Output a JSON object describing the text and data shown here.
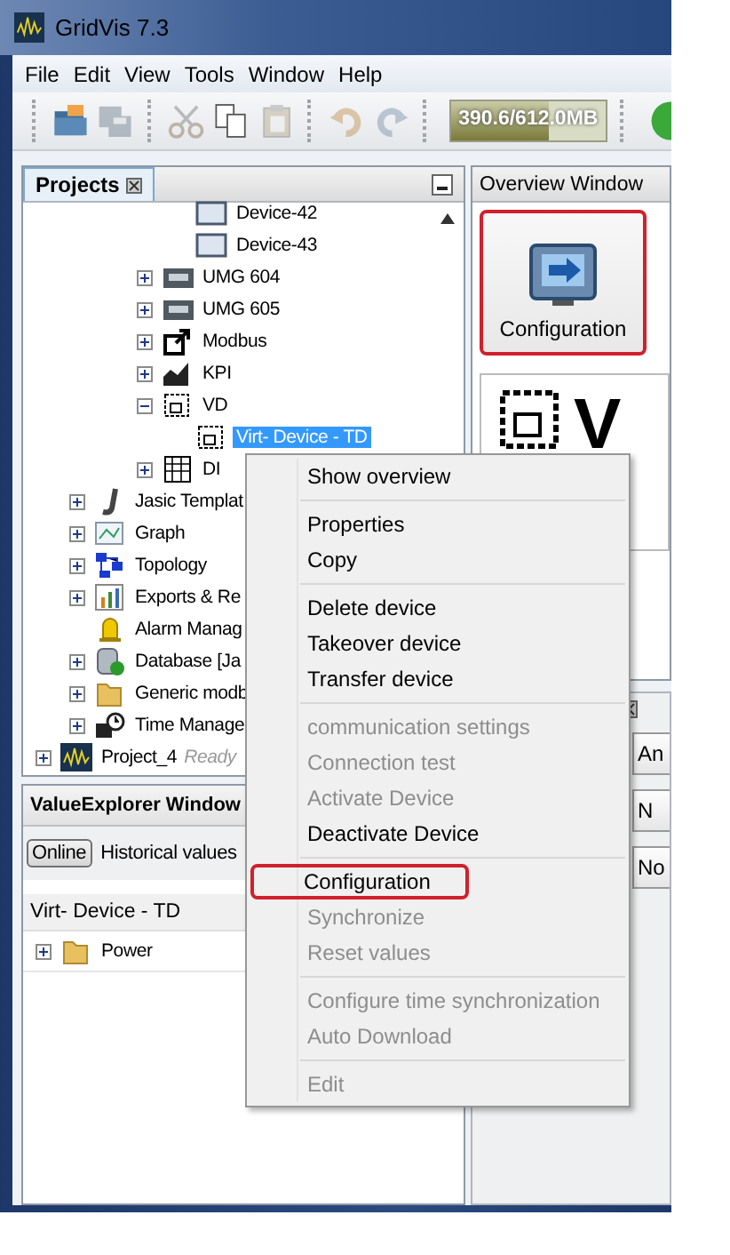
{
  "window": {
    "title": "GridVis 7.3"
  },
  "menu_bar": [
    "File",
    "Edit",
    "View",
    "Tools",
    "Window",
    "Help"
  ],
  "toolbar": {
    "buttons": [
      {
        "kind": "open",
        "disabled": false
      },
      {
        "kind": "save",
        "disabled": true
      },
      {
        "kind": "cut",
        "disabled": true
      },
      {
        "kind": "copy",
        "disabled": false
      },
      {
        "kind": "paste",
        "disabled": true
      },
      {
        "kind": "undo",
        "disabled": true
      },
      {
        "kind": "redo",
        "disabled": true
      }
    ],
    "memory": {
      "reading": "390.6/612.0MB",
      "level": 0.64
    }
  },
  "projects": {
    "title": "Projects",
    "tree": [
      {
        "children": [
          {
            "children": [
              {
                "children": [
                  {
                    "children": [
                      {
                        "label": "Device-42",
                        "kind": "monitor",
                        "selected": false
                      },
                      {
                        "label": "Device-43",
                        "kind": "monitor",
                        "selected": false
                      }
                    ]
                  },
                  {
                    "label": "UMG 604",
                    "kind": "meter",
                    "expanded": false,
                    "selected": false
                  },
                  {
                    "label": "UMG 605",
                    "kind": "meter",
                    "expanded": false,
                    "selected": false
                  },
                  {
                    "label": "Modbus",
                    "kind": "modbus",
                    "expanded": false,
                    "selected": false
                  },
                  {
                    "label": "KPI",
                    "kind": "kpi",
                    "expanded": false,
                    "selected": false
                  },
                  {
                    "label": "VD",
                    "kind": "virtual",
                    "expanded": true,
                    "selected": false,
                    "children": [
                      {
                        "label": "Virt- Device - TD",
                        "kind": "virtual",
                        "selected": true
                      }
                    ]
                  },
                  {
                    "label": "DI",
                    "kind": "di",
                    "expanded": false,
                    "selected": false
                  }
                ]
              }
            ]
          },
          {
            "label": "Jasic Templat",
            "kind": "script",
            "expanded": false,
            "selected": false
          },
          {
            "label": "Graph",
            "kind": "graph",
            "expanded": false,
            "selected": false
          },
          {
            "label": "Topology",
            "kind": "topology",
            "expanded": false,
            "selected": false
          },
          {
            "label": "Exports & Re",
            "kind": "report",
            "expanded": false,
            "selected": false
          },
          {
            "label": "Alarm Manag",
            "kind": "alarm",
            "selected": false
          },
          {
            "label": "Database [Ja",
            "kind": "database",
            "expanded": false,
            "selected": false
          },
          {
            "label": "Generic modb",
            "kind": "folder",
            "expanded": false,
            "selected": false
          },
          {
            "label": "Time Manage",
            "kind": "clock",
            "expanded": false,
            "selected": false
          }
        ]
      },
      {
        "label": "Project_4",
        "status": "Ready",
        "kind": "project",
        "expanded": false,
        "selected": false
      }
    ]
  },
  "value_explorer": {
    "title": "ValueExplorer Window",
    "modes": [
      {
        "label": "Online",
        "selected": true
      },
      {
        "label": "Historical values",
        "selected": false
      }
    ],
    "column": "Virt- Device - TD",
    "tree": [
      {
        "label": "Power",
        "kind": "folder",
        "expanded": false
      }
    ]
  },
  "overview": {
    "title": "Overview Window",
    "buttons": [
      {
        "label": "Configuration",
        "highlighted": true
      }
    ],
    "panel_text": "V",
    "fields": [
      "An",
      "N",
      "No"
    ]
  },
  "context_menu": {
    "sections": [
      [
        {
          "label": "Show overview",
          "disabled": false,
          "highlighted": false
        }
      ],
      [
        {
          "label": "Properties",
          "disabled": false,
          "highlighted": false
        },
        {
          "label": "Copy",
          "disabled": false,
          "highlighted": false
        }
      ],
      [
        {
          "label": "Delete device",
          "disabled": false,
          "highlighted": false
        },
        {
          "label": "Takeover device",
          "disabled": false,
          "highlighted": false
        },
        {
          "label": "Transfer device",
          "disabled": false,
          "highlighted": false
        }
      ],
      [
        {
          "label": "communication settings",
          "disabled": true,
          "highlighted": false
        },
        {
          "label": "Connection test",
          "disabled": true,
          "highlighted": false
        },
        {
          "label": "Activate Device",
          "disabled": true,
          "highlighted": false
        },
        {
          "label": "Deactivate Device",
          "disabled": false,
          "highlighted": false
        }
      ],
      [
        {
          "label": "Configuration",
          "disabled": false,
          "highlighted": true
        },
        {
          "label": "Synchronize",
          "disabled": true,
          "highlighted": false
        },
        {
          "label": "Reset values",
          "disabled": true,
          "highlighted": false
        }
      ],
      [
        {
          "label": "Configure time synchronization",
          "disabled": true,
          "highlighted": false
        },
        {
          "label": "Auto Download",
          "disabled": true,
          "highlighted": false
        }
      ],
      [
        {
          "label": "Edit",
          "disabled": true,
          "highlighted": false
        }
      ]
    ]
  }
}
